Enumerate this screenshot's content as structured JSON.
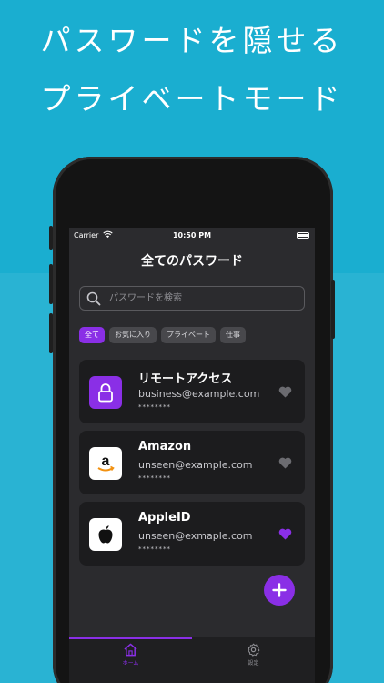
{
  "promo": {
    "line1": "パスワードを隠せる",
    "line2": "プライベートモード"
  },
  "status_bar": {
    "carrier": "Carrier",
    "time": "10:50 PM"
  },
  "header": {
    "title": "全てのパスワード"
  },
  "search": {
    "placeholder": "パスワードを検索"
  },
  "filters": [
    {
      "label": "全て",
      "active": true
    },
    {
      "label": "お気に入り",
      "active": false
    },
    {
      "label": "プライベート",
      "active": false
    },
    {
      "label": "仕事",
      "active": false
    }
  ],
  "items": [
    {
      "name": "リモートアクセス",
      "email": "business@example.com",
      "password": "********",
      "icon": "lock-icon",
      "favorite": false
    },
    {
      "name": "Amazon",
      "email": "unseen@example.com",
      "password": "********",
      "icon": "amazon-logo-icon",
      "favorite": false
    },
    {
      "name": "AppleID",
      "email": "unseen@exmaple.com",
      "password": "********",
      "icon": "apple-logo-icon",
      "favorite": true
    }
  ],
  "tabs": {
    "home": "ホーム",
    "settings": "設定"
  },
  "colors": {
    "accent": "#8a2fe6",
    "background": "#1aaed0"
  }
}
